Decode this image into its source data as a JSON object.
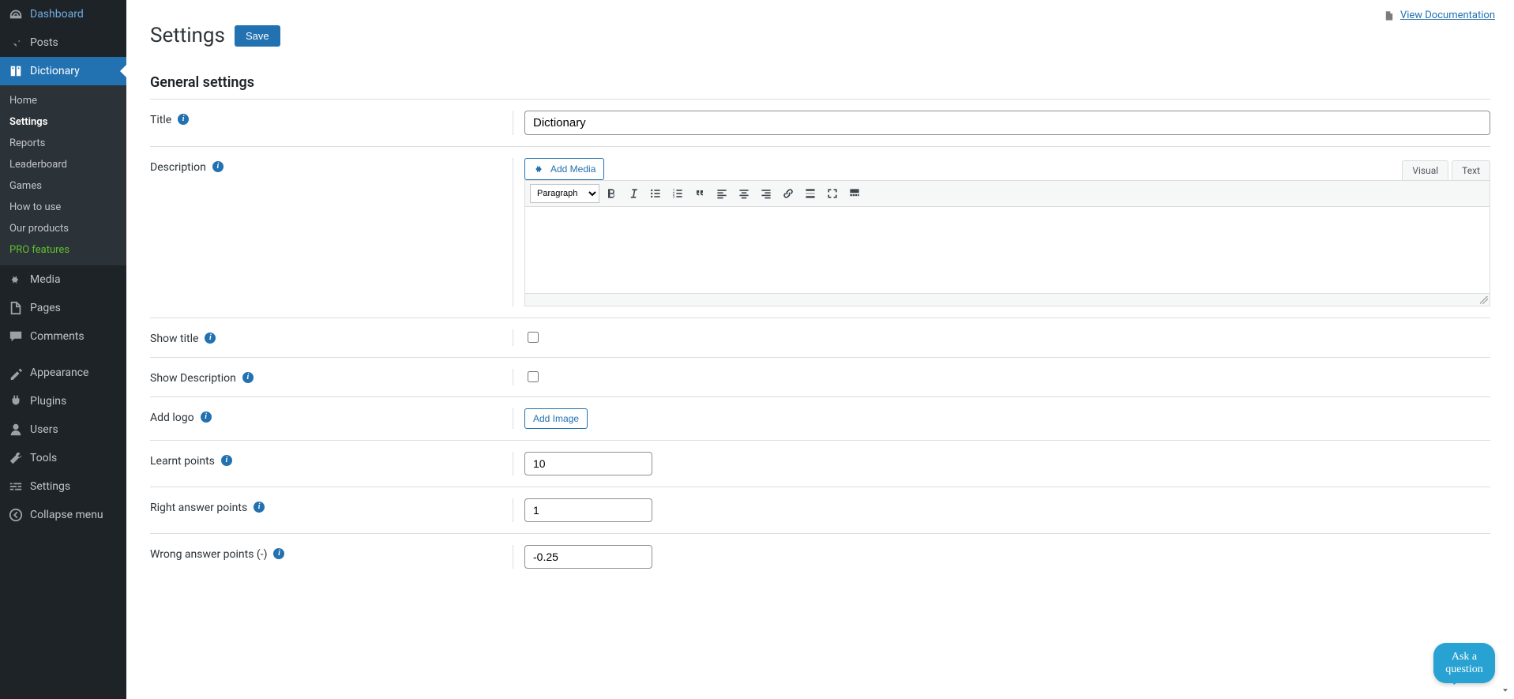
{
  "sidebar": {
    "items": [
      {
        "label": "Dashboard"
      },
      {
        "label": "Posts"
      },
      {
        "label": "Dictionary"
      },
      {
        "label": "Media"
      },
      {
        "label": "Pages"
      },
      {
        "label": "Comments"
      },
      {
        "label": "Appearance"
      },
      {
        "label": "Plugins"
      },
      {
        "label": "Users"
      },
      {
        "label": "Tools"
      },
      {
        "label": "Settings"
      }
    ],
    "submenu": [
      {
        "label": "Home"
      },
      {
        "label": "Settings"
      },
      {
        "label": "Reports"
      },
      {
        "label": "Leaderboard"
      },
      {
        "label": "Games"
      },
      {
        "label": "How to use"
      },
      {
        "label": "Our products"
      },
      {
        "label": "PRO features"
      }
    ],
    "collapse_label": "Collapse menu"
  },
  "header": {
    "view_docs": "View Documentation",
    "page_title": "Settings",
    "save_button": "Save"
  },
  "section": {
    "general": "General settings"
  },
  "fields": {
    "title": {
      "label": "Title",
      "value": "Dictionary"
    },
    "description": {
      "label": "Description"
    },
    "show_title": {
      "label": "Show title"
    },
    "show_description": {
      "label": "Show Description"
    },
    "add_logo": {
      "label": "Add logo",
      "button": "Add Image"
    },
    "learnt_points": {
      "label": "Learnt points",
      "value": "10"
    },
    "right_answer_points": {
      "label": "Right answer points",
      "value": "1"
    },
    "wrong_answer_points": {
      "label": "Wrong answer points (-)",
      "value": "-0.25"
    }
  },
  "editor": {
    "add_media": "Add Media",
    "tab_visual": "Visual",
    "tab_text": "Text",
    "format_select": "Paragraph"
  },
  "ask_widget": {
    "line1": "Ask a",
    "line2": "question"
  }
}
